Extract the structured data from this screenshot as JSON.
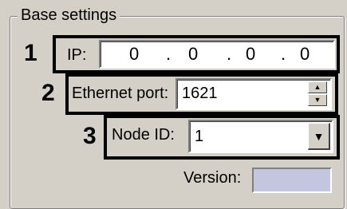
{
  "groupbox": {
    "title": "Base settings"
  },
  "steps": {
    "one": "1",
    "two": "2",
    "three": "3"
  },
  "ip": {
    "label": "IP:",
    "octets": [
      "0",
      "0",
      "0",
      "0"
    ],
    "separator": "."
  },
  "ethernet_port": {
    "label": "Ethernet port:",
    "value": "1621",
    "spin_up": "▲",
    "spin_down": "▼"
  },
  "node_id": {
    "label": "Node ID:",
    "value": "1",
    "dropdown_arrow": "▼"
  },
  "version": {
    "label": "Version:",
    "value": ""
  },
  "icons": {
    "spin_up": "chevron-up-icon",
    "spin_down": "chevron-down-icon",
    "dropdown": "dropdown-arrow-icon"
  },
  "colors": {
    "background": "#d4d0c8",
    "highlight_border": "#000000",
    "version_field": "#c4c6e0"
  }
}
